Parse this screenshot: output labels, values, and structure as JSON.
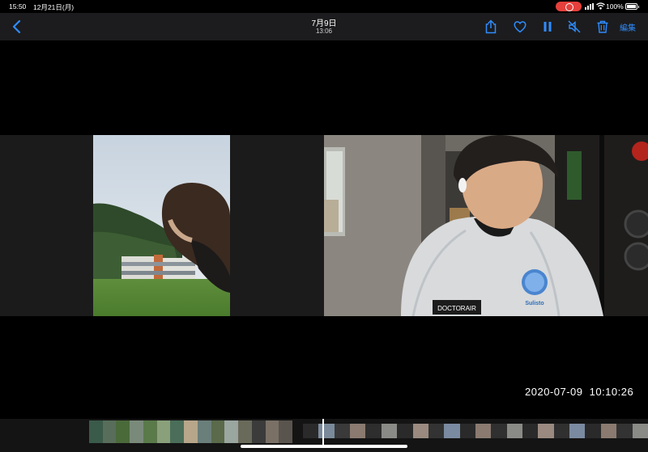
{
  "status_bar": {
    "time": "15:50",
    "date": "12月21日(月)",
    "battery_pct": "100%",
    "recording_color": "#e5403b"
  },
  "nav": {
    "title": "7月9日",
    "subtitle": "13:06",
    "edit_label": "編集",
    "accent_color": "#2f8cff",
    "icons": [
      "back-chevron-icon",
      "share-icon",
      "heart-icon",
      "pause-icon",
      "mute-icon",
      "trash-icon"
    ]
  },
  "video": {
    "timestamp": "2020-07-09  10:10:26",
    "badge_doctorair": "DOCTORAIR",
    "badge_sulisto": "Sulisto"
  },
  "filmstrip": {
    "progress": 0.66
  }
}
